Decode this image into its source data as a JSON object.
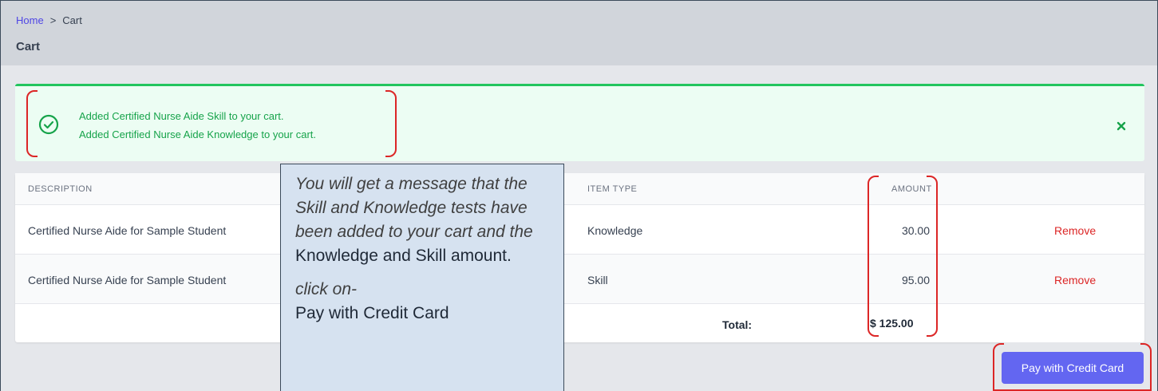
{
  "breadcrumb": {
    "home": "Home",
    "separator": ">",
    "current": "Cart"
  },
  "page": {
    "title": "Cart"
  },
  "alert": {
    "messages": [
      "Added Certified Nurse Aide Skill to your cart.",
      "Added Certified Nurse Aide Knowledge to your cart."
    ]
  },
  "table": {
    "headers": {
      "description": "DESCRIPTION",
      "item_type": "ITEM TYPE",
      "amount": "AMOUNT"
    },
    "rows": [
      {
        "description": "Certified Nurse Aide for Sample Student",
        "item_type": "Knowledge",
        "amount": "30.00",
        "action": "Remove"
      },
      {
        "description": "Certified Nurse Aide for Sample Student",
        "item_type": "Skill",
        "amount": "95.00",
        "action": "Remove"
      }
    ],
    "total_label": "Total:",
    "total_value": "$ 125.00"
  },
  "pay_button": {
    "label": "Pay with Credit Card"
  },
  "callout": {
    "line1_italic": "You will get a message that the Skill and Knowledge tests have been added to your cart and the ",
    "line1_plain": "Knowledge and Skill amount.",
    "line2_italic": "click on-",
    "line2_plain": "Pay with Credit Card"
  },
  "colors": {
    "accent": "#6366f1",
    "success": "#16a34a",
    "danger": "#dc2626",
    "link": "#4f46e5"
  }
}
